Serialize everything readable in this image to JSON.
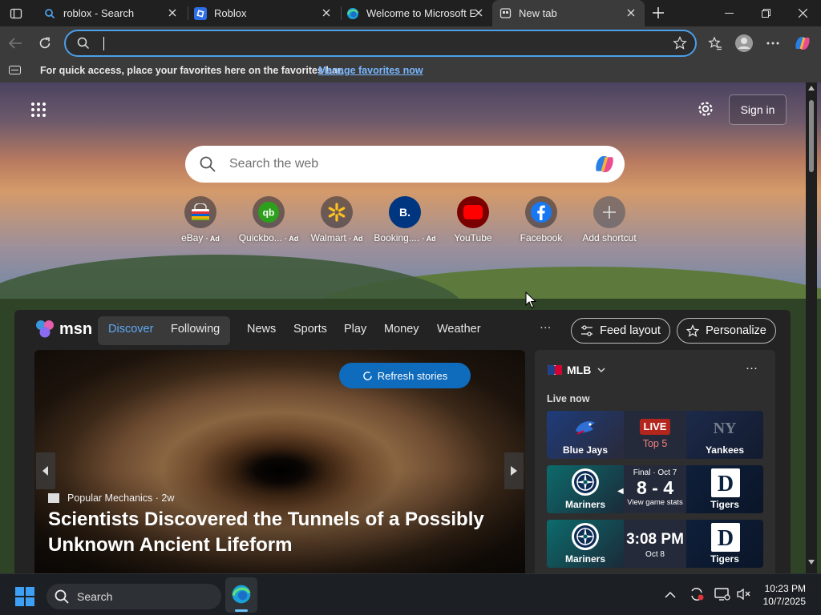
{
  "tabs": [
    {
      "title": "roblox - Search",
      "icon": "search-icon"
    },
    {
      "title": "Roblox",
      "icon": "roblox-icon"
    },
    {
      "title": "Welcome to Microsoft E",
      "icon": "edge-icon"
    },
    {
      "title": "New tab",
      "icon": "newtab-icon"
    }
  ],
  "favorites_bar": {
    "message": "For quick access, place your favorites here on the favorites bar.",
    "link": "Manage favorites now"
  },
  "newtab": {
    "sign_in": "Sign in",
    "search_placeholder": "Search the web",
    "shortcuts": [
      {
        "label": "eBay",
        "ad": "· Ad",
        "icon": "ebay-icon"
      },
      {
        "label": "Quickbo...",
        "ad": "· Ad",
        "icon": "quickbooks-icon"
      },
      {
        "label": "Walmart",
        "ad": "· Ad",
        "icon": "walmart-icon"
      },
      {
        "label": "Booking....",
        "ad": "· Ad",
        "icon": "booking-icon"
      },
      {
        "label": "YouTube",
        "ad": "",
        "icon": "youtube-icon"
      },
      {
        "label": "Facebook",
        "ad": "",
        "icon": "facebook-icon"
      },
      {
        "label": "Add shortcut",
        "ad": "",
        "icon": "plus-icon"
      }
    ]
  },
  "feed": {
    "brand": "msn",
    "tabs": [
      "Discover",
      "Following"
    ],
    "nav": [
      "News",
      "Sports",
      "Play",
      "Money",
      "Weather"
    ],
    "more": "···",
    "feed_layout": "Feed layout",
    "personalize": "Personalize",
    "refresh": "Refresh stories",
    "hero": {
      "source": "Popular Mechanics",
      "age": "· 2w",
      "headline": "Scientists Discovered the Tunnels of a Possibly Unknown Ancient Lifeform"
    },
    "sports": {
      "league": "MLB",
      "more": "···",
      "live_now": "Live now",
      "games": [
        {
          "home": "Blue Jays",
          "away": "Yankees",
          "line1": "LIVE",
          "line2": "Top 5",
          "line3": ""
        },
        {
          "home": "Mariners",
          "away": "Tigers",
          "line1": "Final · Oct 7",
          "line2": "8 - 4",
          "line3": "View game stats"
        },
        {
          "home": "Mariners",
          "away": "Tigers",
          "line1": "",
          "line2": "3:08 PM",
          "line3": "Oct 8"
        }
      ]
    }
  },
  "taskbar": {
    "search": "Search",
    "time": "10:23 PM",
    "date": "10/7/2025"
  },
  "colors": {
    "accent": "#0f6cbd",
    "link": "#78b7ff",
    "nav_selected": "#5ea8f5"
  }
}
